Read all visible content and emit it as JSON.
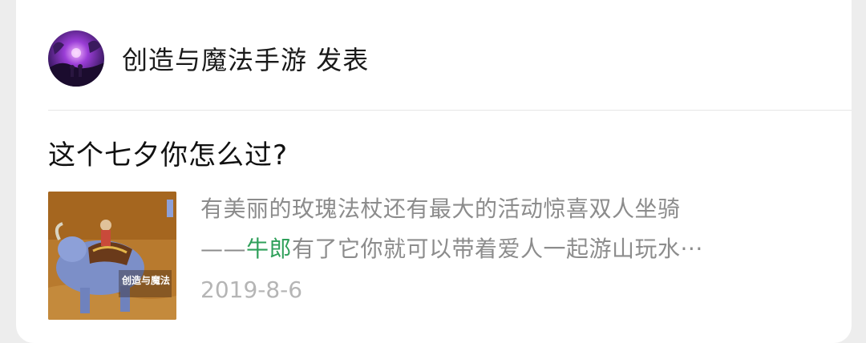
{
  "post": {
    "author": "创造与魔法手游",
    "action": "发表",
    "title": "这个七夕你怎么过?"
  },
  "article": {
    "line1": "有美丽的玫瑰法杖还有最大的活动惊喜双人坐骑",
    "line2_prefix": "——",
    "line2_highlight": "牛郎",
    "line2_rest": "有了它你就可以带着爱人一起游山玩水···",
    "date": "2019-8-6",
    "thumb_logo": "创造与魔法"
  },
  "colors": {
    "highlight": "#2fa05a",
    "summary": "#8c8c8c",
    "date": "#b5b5b5"
  }
}
